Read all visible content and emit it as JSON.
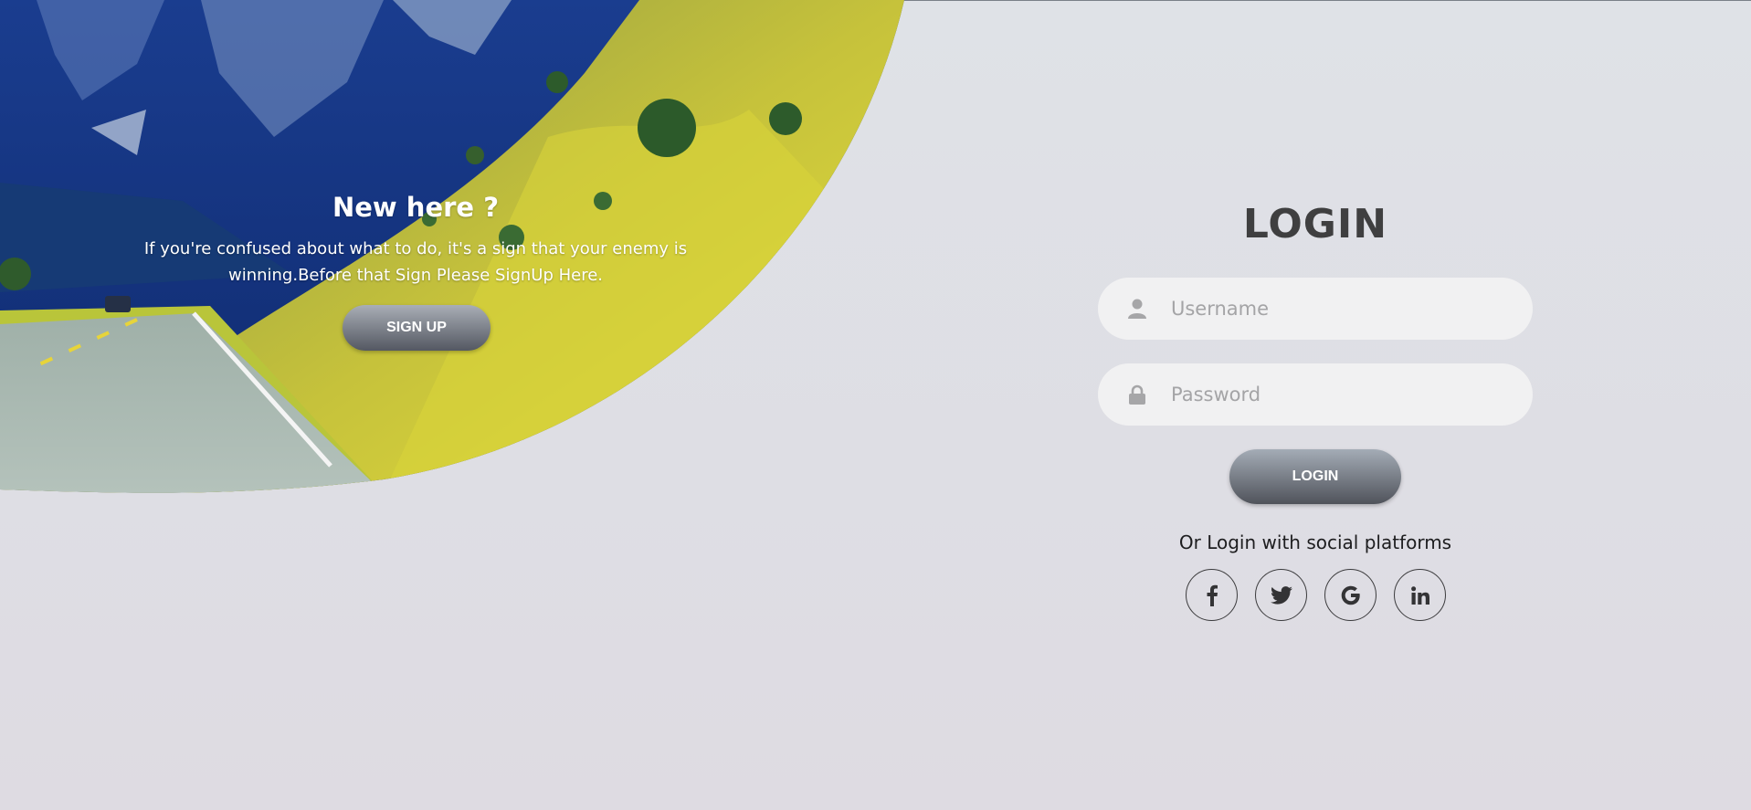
{
  "hero": {
    "title": "New here ?",
    "text": "If you're confused about what to do, it's a sign that your enemy is winning.Before that Sign Please SignUp Here.",
    "signup_label": "SIGN UP"
  },
  "login": {
    "title": "LOGIN",
    "username_placeholder": "Username",
    "password_placeholder": "Password",
    "login_label": "LOGIN",
    "social_text": "Or Login with social platforms",
    "social": [
      {
        "icon": "facebook-icon",
        "glyph": "f"
      },
      {
        "icon": "twitter-icon",
        "glyph": "bird"
      },
      {
        "icon": "google-icon",
        "glyph": "G"
      },
      {
        "icon": "linkedin-icon",
        "glyph": "in"
      }
    ]
  },
  "colors": {
    "background": "#dfe2e7",
    "field_bg": "#f1f1f2",
    "button_top": "#a4acb6",
    "button_bottom": "#50535b",
    "title_text": "#3f3f40"
  }
}
